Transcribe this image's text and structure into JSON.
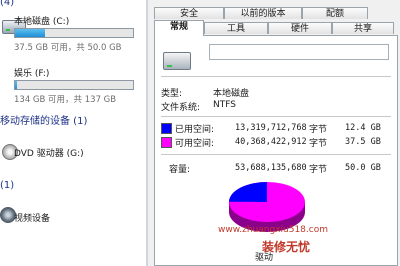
{
  "left": {
    "top_section_num": "(4)",
    "drive_c": {
      "name": "本地磁盘 (C:)",
      "info": "37.5 GB 可用，共 50.0 GB",
      "used_fraction": 0.25
    },
    "drive_f": {
      "name": "娱乐 (F:)",
      "info": "134 GB 可用，共 137 GB",
      "used_fraction": 0.02
    },
    "removable_section": "移动存储的设备 (1)",
    "dvd": {
      "name": "DVD 驱动器 (G:)"
    },
    "other_section": "(1)",
    "video": {
      "name": "视频设备"
    }
  },
  "dialog": {
    "tabs_row1": [
      "安全",
      "以前的版本",
      "配额"
    ],
    "tabs_row2": [
      "常规",
      "工具",
      "硬件",
      "共享"
    ],
    "active_tab": "常规",
    "type_label": "类型:",
    "type_value": "本地磁盘",
    "fs_label": "文件系统:",
    "fs_value": "NTFS",
    "used": {
      "label": "已用空间:",
      "bytes": "13,319,712,768",
      "unit": "字节",
      "size": "12.4 GB",
      "color": "#0000ff"
    },
    "free": {
      "label": "可用空间:",
      "bytes": "40,368,422,912",
      "unit": "字节",
      "size": "37.5 GB",
      "color": "#ff00ff"
    },
    "capacity": {
      "label": "容量:",
      "bytes": "53,688,135,680",
      "unit": "字节",
      "size": "50.0 GB"
    },
    "drive_tag": "驱动"
  },
  "watermark": {
    "url": "www.zhuangxiu518.com",
    "text": "装修无忧"
  }
}
